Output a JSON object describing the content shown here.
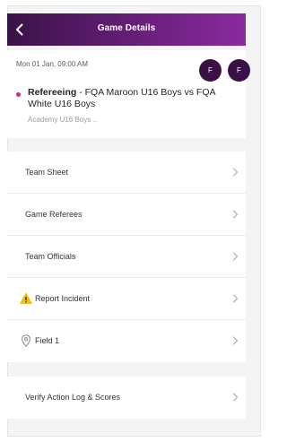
{
  "header": {
    "title": "Game Details",
    "back_icon": "chevron-left-icon",
    "color_start": "#3a1248",
    "color_end": "#8b2aa0"
  },
  "game": {
    "datetime": "Mon 01 Jan, 09:00 AM",
    "avatars": [
      "F",
      "F"
    ],
    "type_label": "Refereeing",
    "separator": " - ",
    "name": "FQA Maroon U16 Boys vs FQA White U16 Boys",
    "competition": "Academy U16 Boys ..",
    "status_color": "#e0208a"
  },
  "menu": {
    "team_sheet": "Team Sheet",
    "game_referees": "Game Referees",
    "team_officials": "Team Officials",
    "report_incident": "Report Incident",
    "field": "Field 1",
    "verify": "Verify Action Log & Scores"
  },
  "icons": {
    "warning": "warning-icon",
    "location": "location-pin-icon",
    "chevron": "chevron-right-icon"
  }
}
